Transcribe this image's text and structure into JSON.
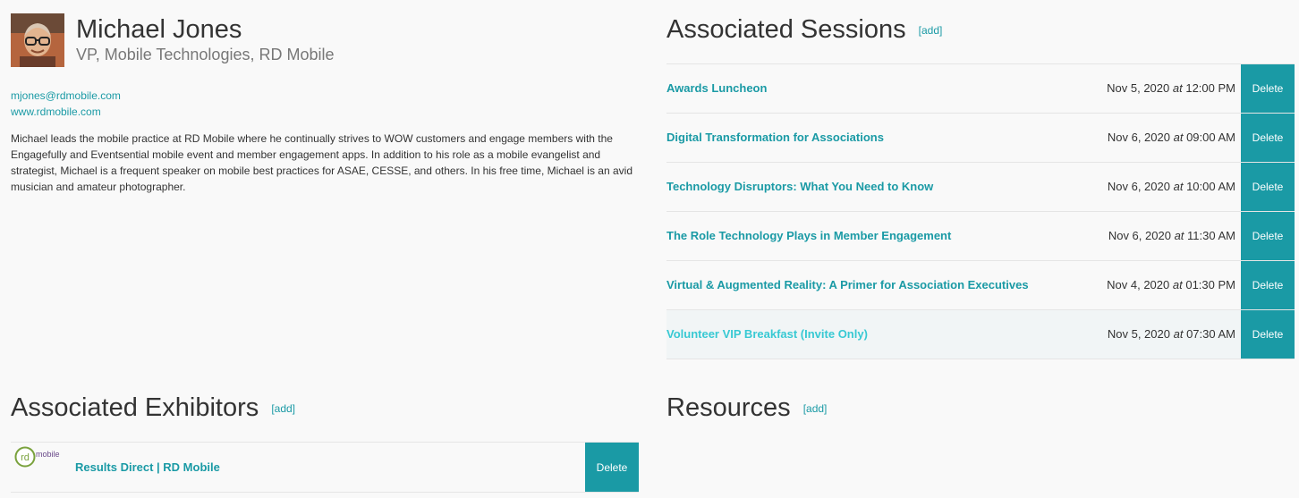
{
  "speaker": {
    "name": "Michael Jones",
    "title": "VP, Mobile Technologies, RD Mobile",
    "email": "mjones@rdmobile.com",
    "website": "www.rdmobile.com",
    "bio": "Michael leads the mobile practice at RD Mobile where he continually strives to WOW customers and engage members with the Engagefully and Eventsential mobile event and member engagement apps. In addition to his role as a mobile evangelist and strategist, Michael is a frequent speaker on mobile best practices for ASAE, CESSE, and others. In his free time, Michael is an avid musician and amateur photographer."
  },
  "sessions": {
    "heading": "Associated Sessions",
    "add_label": "[add]",
    "delete_label": "Delete",
    "at_label": "at",
    "items": [
      {
        "title": "Awards Luncheon",
        "date": "Nov 5, 2020",
        "time": "12:00 PM"
      },
      {
        "title": "Digital Transformation for Associations",
        "date": "Nov 6, 2020",
        "time": "09:00 AM"
      },
      {
        "title": "Technology Disruptors: What You Need to Know",
        "date": "Nov 6, 2020",
        "time": "10:00 AM"
      },
      {
        "title": "The Role Technology Plays in Member Engagement",
        "date": "Nov 6, 2020",
        "time": "11:30 AM"
      },
      {
        "title": "Virtual & Augmented Reality: A Primer for Association Executives",
        "date": "Nov 4, 2020",
        "time": "01:30 PM"
      },
      {
        "title": "Volunteer VIP Breakfast (Invite Only)",
        "date": "Nov 5, 2020",
        "time": "07:30 AM"
      }
    ]
  },
  "exhibitors": {
    "heading": "Associated Exhibitors",
    "add_label": "[add]",
    "delete_label": "Delete",
    "items": [
      {
        "name": "Results Direct | RD Mobile",
        "logo_mark": "rd",
        "logo_text": "mobile"
      }
    ]
  },
  "resources": {
    "heading": "Resources",
    "add_label": "[add]"
  },
  "colors": {
    "accent": "#1a9aa5",
    "link_hover": "#38c9d3",
    "background": "#f9f9f9"
  }
}
